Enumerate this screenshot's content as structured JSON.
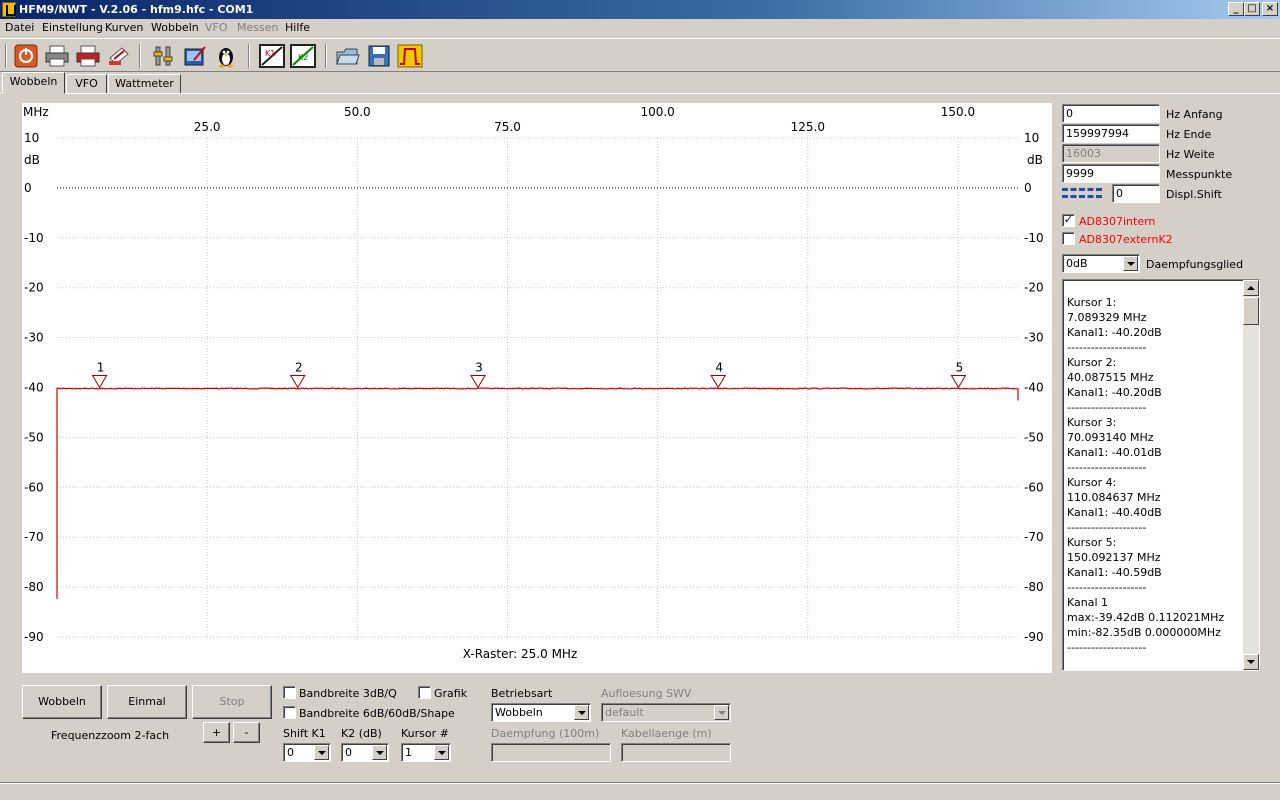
{
  "window": {
    "title": "HFM9/NWT - V.2.06 - hfm9.hfc - COM1",
    "buttons": {
      "minimize": "_",
      "maximize": "□",
      "close": "×"
    }
  },
  "menu": [
    {
      "label": "Datei",
      "enabled": true
    },
    {
      "label": "Einstellung",
      "enabled": true
    },
    {
      "label": "Kurven",
      "enabled": true
    },
    {
      "label": "Wobbeln",
      "enabled": true
    },
    {
      "label": "VFO",
      "enabled": false
    },
    {
      "label": "Messen",
      "enabled": false
    },
    {
      "label": "Hilfe",
      "enabled": true
    }
  ],
  "toolbar_icons": [
    "power-icon",
    "printer-icon",
    "print-color-icon",
    "print-preview-icon",
    "settings-tools-icon",
    "edit-calibrate-icon",
    "linux-penguin-icon",
    "k1-curve-icon",
    "k2-curve-icon",
    "open-folder-icon",
    "save-disk-icon",
    "filter-curve-icon"
  ],
  "tabs": [
    {
      "label": "Wobbeln",
      "active": true
    },
    {
      "label": "VFO",
      "active": false
    },
    {
      "label": "Wattmeter",
      "active": false
    }
  ],
  "plot": {
    "x_unit": "MHz",
    "y_unit": "dB",
    "x_raster_label": "X-Raster: 25.0 MHz",
    "x_ticks_top": [
      "50.0",
      "100.0",
      "150.0"
    ],
    "x_ticks_bottom": [
      "25.0",
      "75.0",
      "125.0"
    ],
    "x_tick_values_top": [
      50,
      100,
      150
    ],
    "x_tick_values_bottom": [
      25,
      75,
      125
    ],
    "x_range_mhz": [
      0,
      160
    ],
    "y_ticks": [
      "10",
      "0",
      "-10",
      "-20",
      "-30",
      "-40",
      "-50",
      "-60",
      "-70",
      "-80",
      "-90"
    ],
    "y_range_db": [
      -90,
      10
    ],
    "trace_color": "#d40000",
    "trace_level_db": -40.2,
    "trace_start_db": -82.35,
    "markers": [
      {
        "label": "1",
        "freq_mhz": 7.089329
      },
      {
        "label": "2",
        "freq_mhz": 40.087515
      },
      {
        "label": "3",
        "freq_mhz": 70.09314
      },
      {
        "label": "4",
        "freq_mhz": 110.084637
      },
      {
        "label": "5",
        "freq_mhz": 150.092137
      }
    ]
  },
  "right_panel": {
    "hz_anfang": {
      "value": "0",
      "label": "Hz Anfang"
    },
    "hz_ende": {
      "value": "159997994",
      "label": "Hz Ende"
    },
    "hz_weite": {
      "value": "16003",
      "label": "Hz Weite"
    },
    "messpunkte": {
      "value": "9999",
      "label": "Messpunkte"
    },
    "displ_shift": {
      "value": "0",
      "label": "Displ.Shift"
    },
    "ad8307intern": {
      "label": "AD8307intern",
      "checked": true
    },
    "ad8307externk2": {
      "label": "AD8307externK2",
      "checked": false
    },
    "daempfungsglied": {
      "value": "0dB",
      "label": "Daempfungsglied"
    },
    "cursor_lines": [
      "Kursor 1:",
      "7.089329 MHz",
      "Kanal1: -40.20dB",
      "--------------------",
      "Kursor 2:",
      "40.087515 MHz",
      "Kanal1: -40.20dB",
      "--------------------",
      "Kursor 3:",
      "70.093140 MHz",
      "Kanal1: -40.01dB",
      "--------------------",
      "Kursor 4:",
      "110.084637 MHz",
      "Kanal1: -40.40dB",
      "--------------------",
      "Kursor 5:",
      "150.092137 MHz",
      "Kanal1: -40.59dB",
      "--------------------",
      "Kanal 1",
      "max:-39.42dB 0.112021MHz",
      "min:-82.35dB 0.000000MHz",
      "--------------------"
    ]
  },
  "bottom": {
    "wobbeln_btn": "Wobbeln",
    "einmal_btn": "Einmal",
    "stop_btn": "Stop",
    "zoom_label": "Frequenzzoom 2-fach",
    "plus_btn": "+",
    "minus_btn": "-",
    "bw3db": {
      "label": "Bandbreite 3dB/Q",
      "checked": false
    },
    "bw6db": {
      "label": "Bandbreite 6dB/60dB/Shape",
      "checked": false
    },
    "grafik": {
      "label": "Grafik",
      "checked": false
    },
    "betriebsart_label": "Betriebsart",
    "betriebsart_value": "Wobbeln",
    "aufloesung_label": "Aufloesung SWV",
    "aufloesung_value": "default",
    "shift_k1_label": "Shift K1",
    "shift_k1_value": "0",
    "k2_label": "K2 (dB)",
    "k2_value": "0",
    "kursor_label": "Kursor #",
    "kursor_value": "1",
    "daempfung_label": "Daempfung (100m)",
    "kabellaenge_label": "Kabellaenge (m)"
  }
}
